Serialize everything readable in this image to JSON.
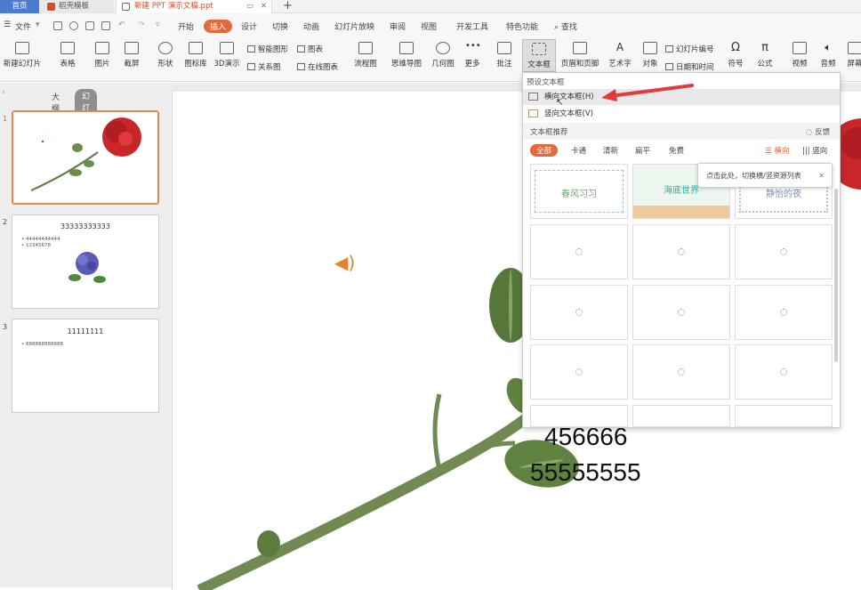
{
  "title_tabs": {
    "home": "首页",
    "templates": "稻壳模板",
    "document": "新建 PPT 演示文稿.ppt"
  },
  "menu": {
    "file": "文件",
    "items": [
      "开始",
      "插入",
      "设计",
      "切换",
      "动画",
      "幻灯片放映",
      "审阅",
      "视图",
      "开发工具",
      "特色功能"
    ],
    "active": "插入",
    "search": "查找"
  },
  "ribbon": {
    "new_slide": "新建幻灯片",
    "table": "表格",
    "picture": "图片",
    "screenshot": "截屏",
    "shape": "形状",
    "icon_lib": "图标库",
    "demo3d": "3D演示",
    "smart_shape": "智能图形",
    "chart": "图表",
    "relation": "关系图",
    "online_chart": "在线图表",
    "flowchart": "流程图",
    "mindmap": "思维导图",
    "geometry": "几何图",
    "more": "更多",
    "comment": "批注",
    "textbox": "文本框",
    "header_footer": "页眉和页脚",
    "wordart": "艺术字",
    "object": "对象",
    "slide_number": "幻灯片编号",
    "datetime": "日期和时间",
    "symbol": "符号",
    "formula": "公式",
    "video": "视频",
    "audio": "音频",
    "screen": "屏幕"
  },
  "left_panel": {
    "tab_outline": "大纲",
    "tab_slides": "幻灯片",
    "slides": [
      {
        "num": "1",
        "title": "",
        "bullets": []
      },
      {
        "num": "2",
        "title": "33333333333",
        "bullets": [
          "44444444444",
          "12345678"
        ]
      },
      {
        "num": "3",
        "title": "11111111",
        "bullets": [
          "888888888888"
        ]
      }
    ]
  },
  "slide": {
    "line1": "456666",
    "line2": "55555555"
  },
  "dropdown": {
    "preset_header": "预设文本框",
    "horizontal": "横向文本框(H)",
    "vertical": "竖向文本框(V)",
    "recommend_header": "文本框推荐",
    "feedback": "反馈",
    "filters": [
      "全部",
      "卡通",
      "清新",
      "扁平",
      "免费"
    ],
    "orient_h": "横向",
    "orient_v": "竖向",
    "cards": [
      "春风习习",
      "海底世界",
      "静怡的夜"
    ],
    "tooltip": "点击此处，切换横/竖资源列表"
  },
  "colors": {
    "accent": "#e2693a",
    "home_tab": "#4a7bd0",
    "arrow": "#e23b3b"
  }
}
